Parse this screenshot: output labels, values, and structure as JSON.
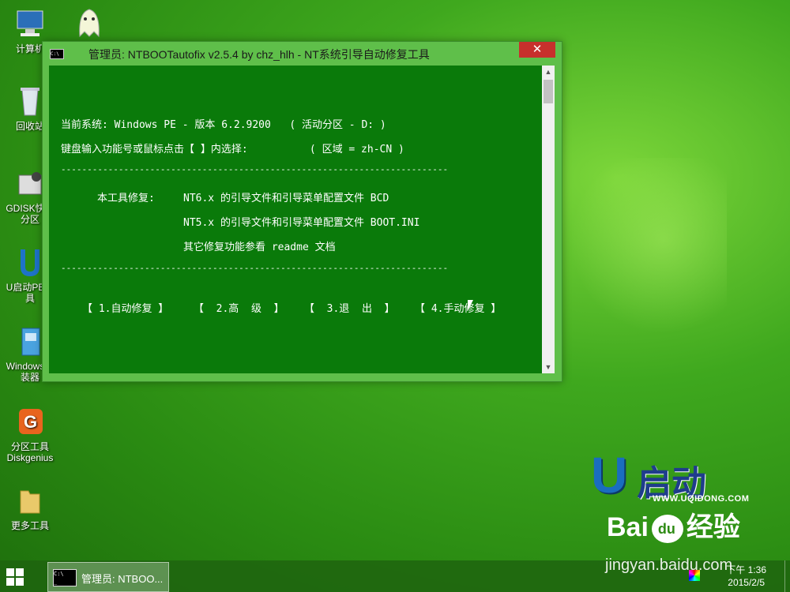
{
  "desktop": {
    "icons": [
      {
        "label": "计算机"
      },
      {
        "label": ""
      },
      {
        "label": "回收站"
      },
      {
        "label": "GDISK快速分区"
      },
      {
        "label": "U启动PE工具"
      },
      {
        "label": "Windows安装器"
      },
      {
        "label": "分区工具\nDiskgenius"
      },
      {
        "label": "更多工具"
      }
    ]
  },
  "window": {
    "title": "管理员: NTBOOTautofix v2.5.4 by chz_hlh - NT系统引导自动修复工具",
    "close_label": "✕",
    "console": {
      "line1": "当前系统: Windows PE - 版本 6.2.9200   ( 活动分区 - D: )",
      "line2": "键盘输入功能号或鼠标点击【 】内选择:          ( 区域 = zh-CN )",
      "separator": "--------------------------------------------------------------------------",
      "repair_label": "本工具修复:",
      "repair1": "NT6.x 的引导文件和引导菜单配置文件 BCD",
      "repair2": "NT5.x 的引导文件和引导菜单配置文件 BOOT.INI",
      "repair3": "其它修复功能参看 readme 文档",
      "options": [
        "【 1.自动修复 】",
        "【  2.高  级  】",
        "【  3.退  出  】",
        "【 4.手动修复 】"
      ]
    }
  },
  "taskbar": {
    "item_label": "管理员: NTBOO...",
    "time": "下午 1:36",
    "date": "2015/2/5"
  },
  "watermark": {
    "logo_text": "启动",
    "logo_url": "WWW.UQIDONG.COM",
    "baidu_left": "Bai",
    "baidu_right": "经验",
    "jingyan": "jingyan.baidu.com"
  }
}
